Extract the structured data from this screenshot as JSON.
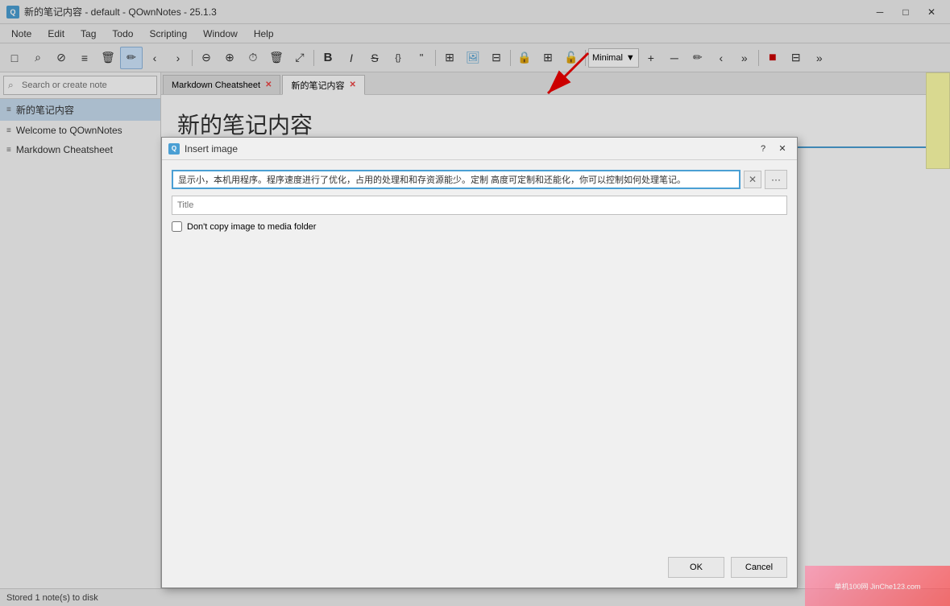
{
  "window": {
    "title": "新的笔记内容 - default - QOwnNotes - 25.1.3",
    "icon": "Q"
  },
  "titlebar": {
    "minimize": "─",
    "maximize": "□",
    "close": "✕"
  },
  "menu": {
    "items": [
      "Note",
      "Edit",
      "Tag",
      "Todo",
      "Scripting",
      "Window",
      "Help"
    ]
  },
  "toolbar": {
    "buttons": [
      {
        "name": "new-note",
        "icon": "□",
        "label": "New Note"
      },
      {
        "name": "search",
        "icon": "🔍",
        "label": "Search"
      },
      {
        "name": "remove-note",
        "icon": "⊘",
        "label": "Remove Note"
      },
      {
        "name": "note-list",
        "icon": "≡",
        "label": "Note List"
      },
      {
        "name": "trash",
        "icon": "🗑",
        "label": "Trash"
      },
      {
        "name": "edit",
        "icon": "✏",
        "label": "Edit"
      },
      {
        "name": "prev",
        "icon": "‹",
        "label": "Previous"
      },
      {
        "name": "next",
        "icon": "›",
        "label": "Next"
      },
      {
        "name": "zoom-out",
        "icon": "🔍−",
        "label": "Zoom Out"
      },
      {
        "name": "zoom-in",
        "icon": "🔍+",
        "label": "Zoom In"
      },
      {
        "name": "clock",
        "icon": "🕐",
        "label": "Clock"
      },
      {
        "name": "delete",
        "icon": "🗑",
        "label": "Delete"
      },
      {
        "name": "move",
        "icon": "⤢",
        "label": "Move"
      }
    ],
    "format_buttons": [
      {
        "name": "bold",
        "icon": "B",
        "label": "Bold"
      },
      {
        "name": "italic",
        "icon": "I",
        "label": "Italic"
      },
      {
        "name": "strikethrough",
        "icon": "S",
        "label": "Strikethrough"
      },
      {
        "name": "code",
        "icon": "{}",
        "label": "Code"
      },
      {
        "name": "quote",
        "icon": "\"",
        "label": "Quote"
      }
    ],
    "insert_buttons": [
      {
        "name": "table",
        "icon": "⊞",
        "label": "Table"
      },
      {
        "name": "image",
        "icon": "🖼",
        "label": "Image"
      },
      {
        "name": "link",
        "icon": "⊟",
        "label": "Link"
      }
    ],
    "lock_buttons": [
      {
        "name": "lock1",
        "icon": "🔒",
        "label": "Lock"
      },
      {
        "name": "lock2",
        "icon": "⊞",
        "label": "Lock2"
      },
      {
        "name": "lock3",
        "icon": "🔓",
        "label": "Unlock"
      }
    ],
    "dropdown": {
      "label": "Minimal",
      "arrow": "▼"
    },
    "extra_buttons": [
      {
        "name": "add",
        "icon": "+",
        "label": "Add"
      },
      {
        "name": "minus",
        "icon": "─",
        "label": "Minus"
      },
      {
        "name": "edit2",
        "icon": "✏",
        "label": "Edit"
      },
      {
        "name": "prev2",
        "icon": "‹",
        "label": "Prev"
      },
      {
        "name": "more",
        "icon": "»",
        "label": "More"
      }
    ],
    "right_buttons": [
      {
        "name": "red-square",
        "icon": "■",
        "label": "Red",
        "color": "#cc0000"
      },
      {
        "name": "stack",
        "icon": "⊟",
        "label": "Stack"
      },
      {
        "name": "more2",
        "icon": "»",
        "label": "More"
      }
    ]
  },
  "sidebar": {
    "search_placeholder": "Search or create note",
    "notes": [
      {
        "name": "新的笔记内容",
        "active": true
      },
      {
        "name": "Welcome to QOwnNotes",
        "active": false
      },
      {
        "name": "Markdown Cheatsheet",
        "active": false
      }
    ]
  },
  "editor": {
    "tabs": [
      {
        "label": "Markdown Cheatsheet",
        "active": false,
        "closable": true
      },
      {
        "label": "新的笔记内容",
        "active": true,
        "closable": true
      }
    ],
    "note_title": "新的笔记内容"
  },
  "dialog": {
    "title": "Insert image",
    "icon": "Q",
    "help_button": "?",
    "close_button": "✕",
    "url_value": "显示小，本机用程序。程序速度进行了优化，占用的处理和和存资源能少。定制 高度可定制和还能化，你可以控制如何处理笔记。",
    "url_placeholder": "",
    "title_placeholder": "Title",
    "checkbox_label": "Don't copy image to media folder",
    "checkbox_checked": false,
    "ok_label": "OK",
    "cancel_label": "Cancel"
  },
  "statusbar": {
    "text": "Stored 1 note(s) to disk"
  },
  "watermark": {
    "text": "单机100网 JinChe123.com"
  }
}
